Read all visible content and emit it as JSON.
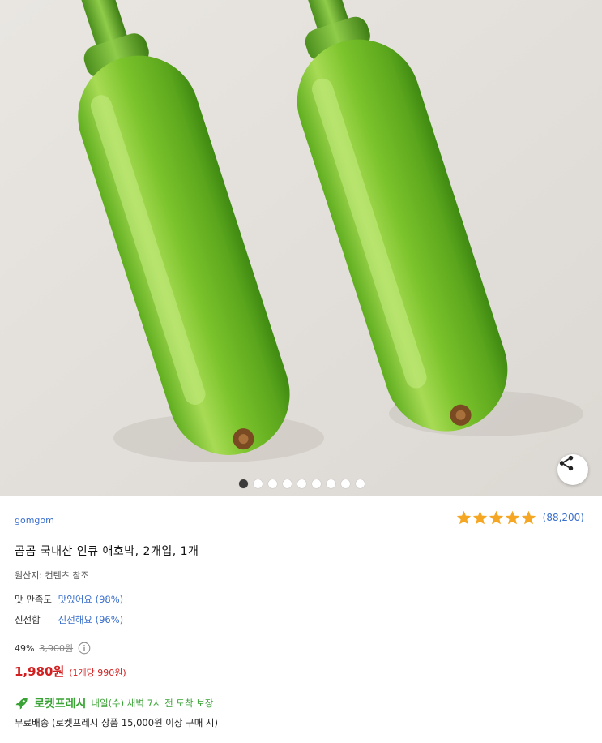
{
  "gallery": {
    "total_images": 9,
    "current_index": 1,
    "share_label": "share"
  },
  "product": {
    "brand": "gomgom",
    "rating_value": 5,
    "review_count": "(88,200)",
    "title": "곰곰 국내산 인큐 애호박, 2개입, 1개",
    "origin": "원산지: 컨텐츠 참조",
    "features": [
      {
        "label": "맛 만족도",
        "value": "맛있어요 (98%)"
      },
      {
        "label": "신선함",
        "value": "신선해요 (96%)"
      }
    ],
    "discount_rate": "49%",
    "original_price": "3,900원",
    "price": "1,980원",
    "unit_price": "(1개당 990원)",
    "delivery_name": "로켓프레시",
    "delivery_eta": "내일(수) 새벽 7시 전 도착 보장",
    "free_shipping": "무료배송 (로켓프레시 상품 15,000원 이상 구매 시)"
  },
  "colors": {
    "brand_link": "#3a6fcc",
    "price_red": "#d21f1f",
    "rocket_green": "#3aa335",
    "star": "#f5a623"
  }
}
